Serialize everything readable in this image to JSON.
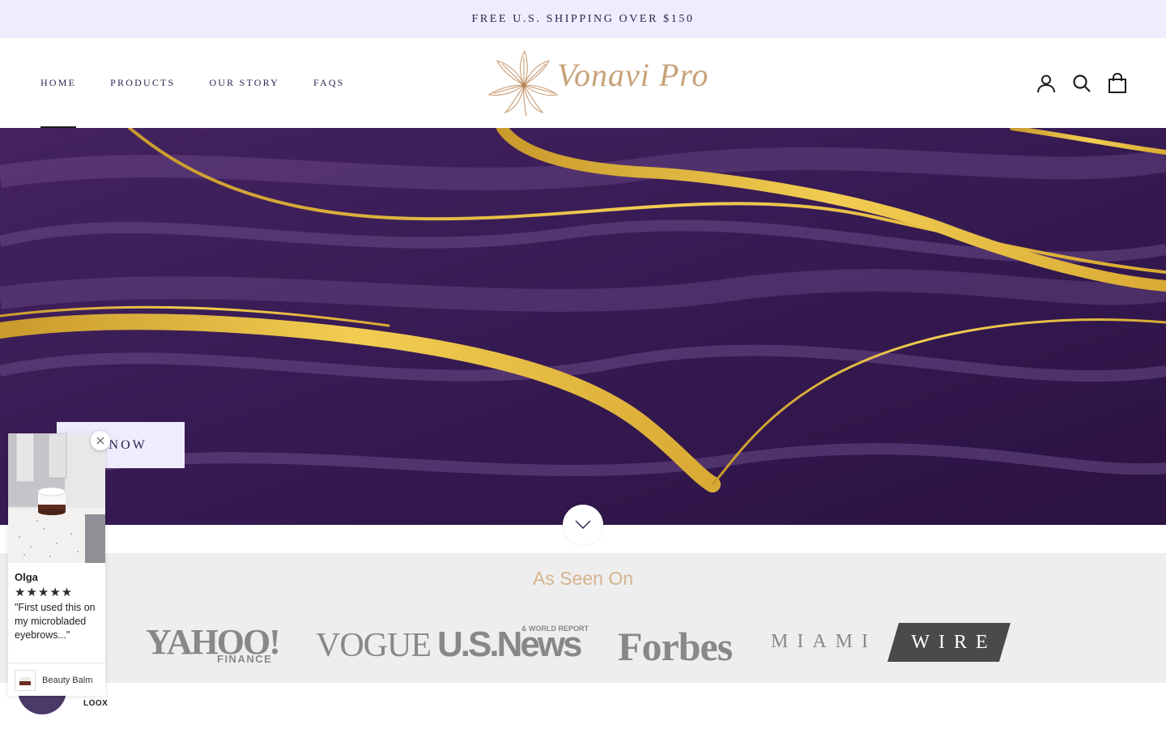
{
  "announcement": {
    "text": "FREE U.S. SHIPPING OVER $150"
  },
  "header": {
    "nav": [
      {
        "label": "HOME",
        "active": true
      },
      {
        "label": "PRODUCTS"
      },
      {
        "label": "OUR STORY"
      },
      {
        "label": "FAQS"
      }
    ],
    "logo": {
      "text": "Vonavi Pro",
      "icon": "lily-flower-icon"
    },
    "icons": [
      "account-icon",
      "search-icon",
      "cart-icon"
    ]
  },
  "hero": {
    "cta_label": "SHOP NOW",
    "visible_cta_text": "P NOW",
    "scroll_icon": "chevron-down-icon",
    "colors": {
      "base": "#3a1c57",
      "gold": "#e5b939"
    }
  },
  "press": {
    "title": "As Seen On",
    "logos": [
      {
        "main": "YAHOO!",
        "sub": "FINANCE"
      },
      {
        "main": "VOGUE"
      },
      {
        "main": "U.S.News",
        "sub": "& WORLD REPORT"
      },
      {
        "main": "Forbes"
      },
      {
        "main": "MIAMI",
        "second": "WIRE"
      }
    ]
  },
  "review_popup": {
    "reviewer": "Olga",
    "stars": "★★★★★",
    "rating": 5,
    "quote": "\"First used this on my microbladed eyebrows...\"",
    "product": "Beauty Balm",
    "brand": "LOOX"
  },
  "colors": {
    "announcement_bg": "#efecfd",
    "text": "#2a2350",
    "press_bg": "#eeeeee",
    "press_title": "#d6b38e"
  }
}
